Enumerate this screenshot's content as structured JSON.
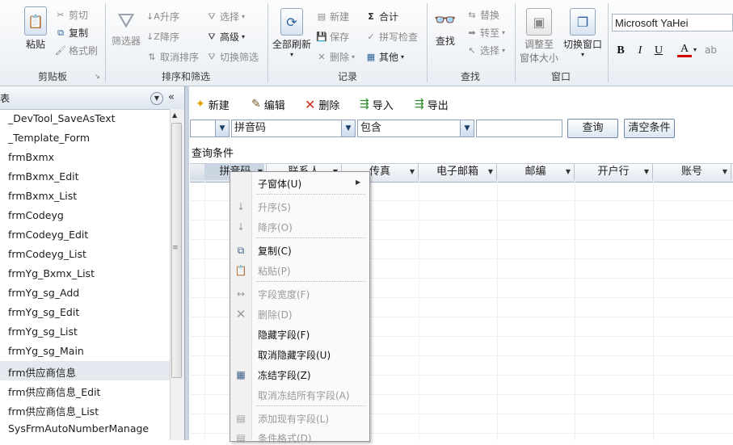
{
  "ribbon": {
    "clipboard": {
      "cut": "剪切",
      "copy": "复制",
      "format_painter": "格式刷",
      "paste": "粘贴",
      "group_label": "剪贴板"
    },
    "sort_filter": {
      "filter": "筛选器",
      "ascending": "升序",
      "descending": "降序",
      "remove_sort": "取消排序",
      "selection": "选择",
      "advanced": "高级",
      "toggle_filter": "切换筛选",
      "group_label": "排序和筛选"
    },
    "records": {
      "refresh_all": "全部刷新",
      "new": "新建",
      "save": "保存",
      "delete": "删除",
      "totals": "合计",
      "spelling": "拼写检查",
      "more": "其他",
      "group_label": "记录"
    },
    "find": {
      "find": "查找",
      "replace": "替换",
      "goto": "转至",
      "select": "选择",
      "group_label": "查找"
    },
    "window": {
      "size_to_fit": "调整至窗体大小",
      "size_line1": "调整至",
      "size_line2": "窗体大小",
      "switch": "切换窗口",
      "group_label": "窗口"
    },
    "font": {
      "name": "Microsoft YaHei",
      "bold": "B",
      "italic": "I",
      "underline": "U",
      "color": "A"
    }
  },
  "nav": {
    "header": "表",
    "items": [
      "_DevTool_SaveAsText",
      "_Template_Form",
      "frmBxmx",
      "frmBxmx_Edit",
      "frmBxmx_List",
      "frmCodeyg",
      "frmCodeyg_Edit",
      "frmCodeyg_List",
      "frmYg_Bxmx_List",
      "frmYg_sg_Add",
      "frmYg_sg_Edit",
      "frmYg_sg_List",
      "frmYg_sg_Main",
      "frm供应商信息",
      "frm供应商信息_Edit",
      "frm供应商信息_List",
      "SysFrmAutoNumberManage"
    ],
    "selected_index": 13
  },
  "form": {
    "toolbar": {
      "new": "新建",
      "edit": "编辑",
      "delete": "删除",
      "import": "导入",
      "export": "导出"
    },
    "filter": {
      "field_combo1": "",
      "field_combo2": "拼音码",
      "operator": "包含",
      "value": "",
      "query_btn": "查询",
      "clear_btn": "清空条件"
    },
    "query_label": "查询条件",
    "columns": [
      "拼音码",
      "联系人",
      "传真",
      "电子邮箱",
      "邮编",
      "开户行",
      "账号"
    ]
  },
  "context_menu": {
    "items": [
      {
        "label": "子窗体(U)",
        "enabled": true,
        "submenu": true,
        "icon": ""
      },
      {
        "label": "升序(S)",
        "enabled": false,
        "icon": "sort-ascending-icon"
      },
      {
        "label": "降序(O)",
        "enabled": false,
        "icon": "sort-descending-icon"
      },
      {
        "label": "复制(C)",
        "enabled": true,
        "icon": "copy-icon"
      },
      {
        "label": "粘贴(P)",
        "enabled": false,
        "icon": "paste-icon"
      },
      {
        "label": "字段宽度(F)",
        "enabled": false,
        "icon": "field-width-icon"
      },
      {
        "label": "删除(D)",
        "enabled": false,
        "icon": "delete-icon"
      },
      {
        "label": "隐藏字段(F)",
        "enabled": true,
        "icon": ""
      },
      {
        "label": "取消隐藏字段(U)",
        "enabled": true,
        "icon": ""
      },
      {
        "label": "冻结字段(Z)",
        "enabled": true,
        "icon": "freeze-icon"
      },
      {
        "label": "取消冻结所有字段(A)",
        "enabled": false,
        "icon": ""
      },
      {
        "label": "添加现有字段(L)",
        "enabled": false,
        "icon": "add-field-icon"
      },
      {
        "label": "条件格式(D)",
        "enabled": false,
        "icon": "conditional-format-icon"
      }
    ]
  },
  "colors": {
    "accent": "#2d5f9a",
    "delete_red": "#d42a1c",
    "font_color_bar": "#d40000"
  }
}
